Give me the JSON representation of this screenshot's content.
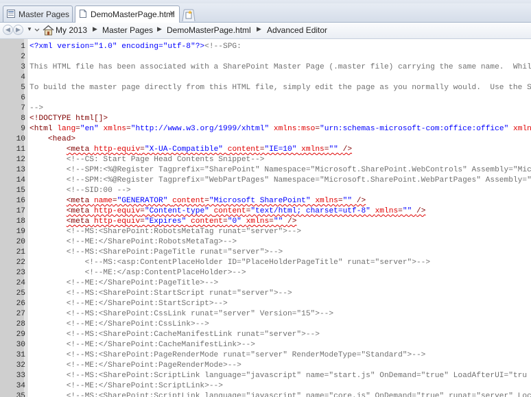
{
  "tabs": [
    {
      "label": "Master Pages",
      "icon": "page-list-icon",
      "active": false
    },
    {
      "label": "DemoMasterPage.html",
      "icon": "html-file-icon",
      "active": true
    }
  ],
  "breadcrumb": [
    "My 2013",
    "Master Pages",
    "DemoMasterPage.html",
    "Advanced Editor"
  ],
  "lines": [
    {
      "n": "1",
      "s": [
        [
          "pi",
          "<?xml version=\"1.0\" encoding=\"utf-8\"?>"
        ],
        [
          "c",
          "<!--SPG:"
        ]
      ]
    },
    {
      "n": "2",
      "s": []
    },
    {
      "n": "3",
      "s": [
        [
          "c",
          "This HTML file has been associated with a SharePoint Master Page (.master file) carrying the same name.  While"
        ]
      ]
    },
    {
      "n": "4",
      "s": []
    },
    {
      "n": "5",
      "s": [
        [
          "c",
          "To build the master page directly from this HTML file, simply edit the page as you normally would.  Use the Sn"
        ]
      ]
    },
    {
      "n": "6",
      "s": []
    },
    {
      "n": "7",
      "s": [
        [
          "c",
          "-->"
        ]
      ]
    },
    {
      "n": "8",
      "s": [
        [
          "t",
          "<!DOCTYPE html[]>"
        ]
      ]
    },
    {
      "n": "9",
      "s": [
        [
          "t",
          "<html "
        ],
        [
          "a",
          "lang"
        ],
        [
          "t",
          "="
        ],
        [
          "v",
          "\"en\" "
        ],
        [
          "a",
          "xmlns"
        ],
        [
          "t",
          "="
        ],
        [
          "v",
          "\"http://www.w3.org/1999/xhtml\" "
        ],
        [
          "a",
          "xmlns:mso"
        ],
        [
          "t",
          "="
        ],
        [
          "v",
          "\"urn:schemas-microsoft-com:office:office\" "
        ],
        [
          "a",
          "xmlns"
        ]
      ]
    },
    {
      "n": "10",
      "s": [
        [
          "x",
          "    "
        ],
        [
          "t",
          "<head>"
        ]
      ]
    },
    {
      "n": "11",
      "s": [
        [
          "x",
          "        "
        ],
        [
          "tq",
          "<meta "
        ],
        [
          "aq",
          "http-equiv"
        ],
        [
          "tq",
          "="
        ],
        [
          "vq",
          "\"X-UA-Compatible\" "
        ],
        [
          "aq",
          "content"
        ],
        [
          "tq",
          "="
        ],
        [
          "vq",
          "\"IE=10\" "
        ],
        [
          "aq",
          "xmlns"
        ],
        [
          "tq",
          "="
        ],
        [
          "vq",
          "\"\" "
        ],
        [
          "tq",
          "/>"
        ]
      ]
    },
    {
      "n": "12",
      "s": [
        [
          "x",
          "        "
        ],
        [
          "c",
          "<!--CS: Start Page Head Contents Snippet-->"
        ]
      ]
    },
    {
      "n": "13",
      "s": [
        [
          "x",
          "        "
        ],
        [
          "c",
          "<!--SPM:<%@Register Tagprefix=\"SharePoint\" Namespace=\"Microsoft.SharePoint.WebControls\" Assembly=\"Micro"
        ]
      ]
    },
    {
      "n": "14",
      "s": [
        [
          "x",
          "        "
        ],
        [
          "c",
          "<!--SPM:<%@Register Tagprefix=\"WebPartPages\" Namespace=\"Microsoft.SharePoint.WebPartPages\" Assembly=\"Mi"
        ]
      ]
    },
    {
      "n": "15",
      "s": [
        [
          "x",
          "        "
        ],
        [
          "c",
          "<!--SID:00 -->"
        ]
      ]
    },
    {
      "n": "16",
      "s": [
        [
          "x",
          "        "
        ],
        [
          "tq",
          "<meta "
        ],
        [
          "aq",
          "name"
        ],
        [
          "tq",
          "="
        ],
        [
          "vq",
          "\"GENERATOR\" "
        ],
        [
          "aq",
          "content"
        ],
        [
          "tq",
          "="
        ],
        [
          "vq",
          "\"Microsoft SharePoint\" "
        ],
        [
          "aq",
          "xmlns"
        ],
        [
          "tq",
          "="
        ],
        [
          "vq",
          "\"\" "
        ],
        [
          "tq",
          "/>"
        ]
      ]
    },
    {
      "n": "17",
      "s": [
        [
          "x",
          "        "
        ],
        [
          "tq",
          "<meta "
        ],
        [
          "aq",
          "http-equiv"
        ],
        [
          "tq",
          "="
        ],
        [
          "vq",
          "\"Content-type\" "
        ],
        [
          "aq",
          "content"
        ],
        [
          "tq",
          "="
        ],
        [
          "vq",
          "\"text/html; charset=utf-8\" "
        ],
        [
          "aq",
          "xmlns"
        ],
        [
          "tq",
          "="
        ],
        [
          "vq",
          "\"\" "
        ],
        [
          "tq",
          "/>"
        ]
      ]
    },
    {
      "n": "18",
      "s": [
        [
          "x",
          "        "
        ],
        [
          "tq",
          "<meta "
        ],
        [
          "aq",
          "http-equiv"
        ],
        [
          "tq",
          "="
        ],
        [
          "vq",
          "\"Expires\" "
        ],
        [
          "aq",
          "content"
        ],
        [
          "tq",
          "="
        ],
        [
          "vq",
          "\"0\" "
        ],
        [
          "aq",
          "xmlns"
        ],
        [
          "tq",
          "="
        ],
        [
          "vq",
          "\"\" "
        ],
        [
          "tq",
          "/>"
        ]
      ]
    },
    {
      "n": "19",
      "s": [
        [
          "x",
          "        "
        ],
        [
          "c",
          "<!--MS:<SharePoint:RobotsMetaTag runat=\"server\">-->"
        ]
      ]
    },
    {
      "n": "20",
      "s": [
        [
          "x",
          "        "
        ],
        [
          "c",
          "<!--ME:</SharePoint:RobotsMetaTag>-->"
        ]
      ]
    },
    {
      "n": "21",
      "s": [
        [
          "x",
          "        "
        ],
        [
          "c",
          "<!--MS:<SharePoint:PageTitle runat=\"server\">-->"
        ]
      ]
    },
    {
      "n": "22",
      "s": [
        [
          "x",
          "            "
        ],
        [
          "c",
          "<!--MS:<asp:ContentPlaceHolder ID=\"PlaceHolderPageTitle\" runat=\"server\">-->"
        ]
      ]
    },
    {
      "n": "23",
      "s": [
        [
          "x",
          "            "
        ],
        [
          "c",
          "<!--ME:</asp:ContentPlaceHolder>-->"
        ]
      ]
    },
    {
      "n": "24",
      "s": [
        [
          "x",
          "        "
        ],
        [
          "c",
          "<!--ME:</SharePoint:PageTitle>-->"
        ]
      ]
    },
    {
      "n": "25",
      "s": [
        [
          "x",
          "        "
        ],
        [
          "c",
          "<!--MS:<SharePoint:StartScript runat=\"server\">-->"
        ]
      ]
    },
    {
      "n": "26",
      "s": [
        [
          "x",
          "        "
        ],
        [
          "c",
          "<!--ME:</SharePoint:StartScript>-->"
        ]
      ]
    },
    {
      "n": "27",
      "s": [
        [
          "x",
          "        "
        ],
        [
          "c",
          "<!--MS:<SharePoint:CssLink runat=\"server\" Version=\"15\">-->"
        ]
      ]
    },
    {
      "n": "28",
      "s": [
        [
          "x",
          "        "
        ],
        [
          "c",
          "<!--ME:</SharePoint:CssLink>-->"
        ]
      ]
    },
    {
      "n": "29",
      "s": [
        [
          "x",
          "        "
        ],
        [
          "c",
          "<!--MS:<SharePoint:CacheManifestLink runat=\"server\">-->"
        ]
      ]
    },
    {
      "n": "30",
      "s": [
        [
          "x",
          "        "
        ],
        [
          "c",
          "<!--ME:</SharePoint:CacheManifestLink>-->"
        ]
      ]
    },
    {
      "n": "31",
      "s": [
        [
          "x",
          "        "
        ],
        [
          "c",
          "<!--MS:<SharePoint:PageRenderMode runat=\"server\" RenderModeType=\"Standard\">-->"
        ]
      ]
    },
    {
      "n": "32",
      "s": [
        [
          "x",
          "        "
        ],
        [
          "c",
          "<!--ME:</SharePoint:PageRenderMode>-->"
        ]
      ]
    },
    {
      "n": "33",
      "s": [
        [
          "x",
          "        "
        ],
        [
          "c",
          "<!--MS:<SharePoint:ScriptLink language=\"javascript\" name=\"start.js\" OnDemand=\"true\" LoadAfterUI=\"tru"
        ]
      ]
    },
    {
      "n": "34",
      "s": [
        [
          "x",
          "        "
        ],
        [
          "c",
          "<!--ME:</SharePoint:ScriptLink>-->"
        ]
      ]
    },
    {
      "n": "35",
      "s": [
        [
          "x",
          "        "
        ],
        [
          "c",
          "<!--MS:<SharePoint:ScriptLink language=\"javascript\" name=\"core.js\" OnDemand=\"true\" runat=\"server\" Loc"
        ]
      ]
    }
  ]
}
